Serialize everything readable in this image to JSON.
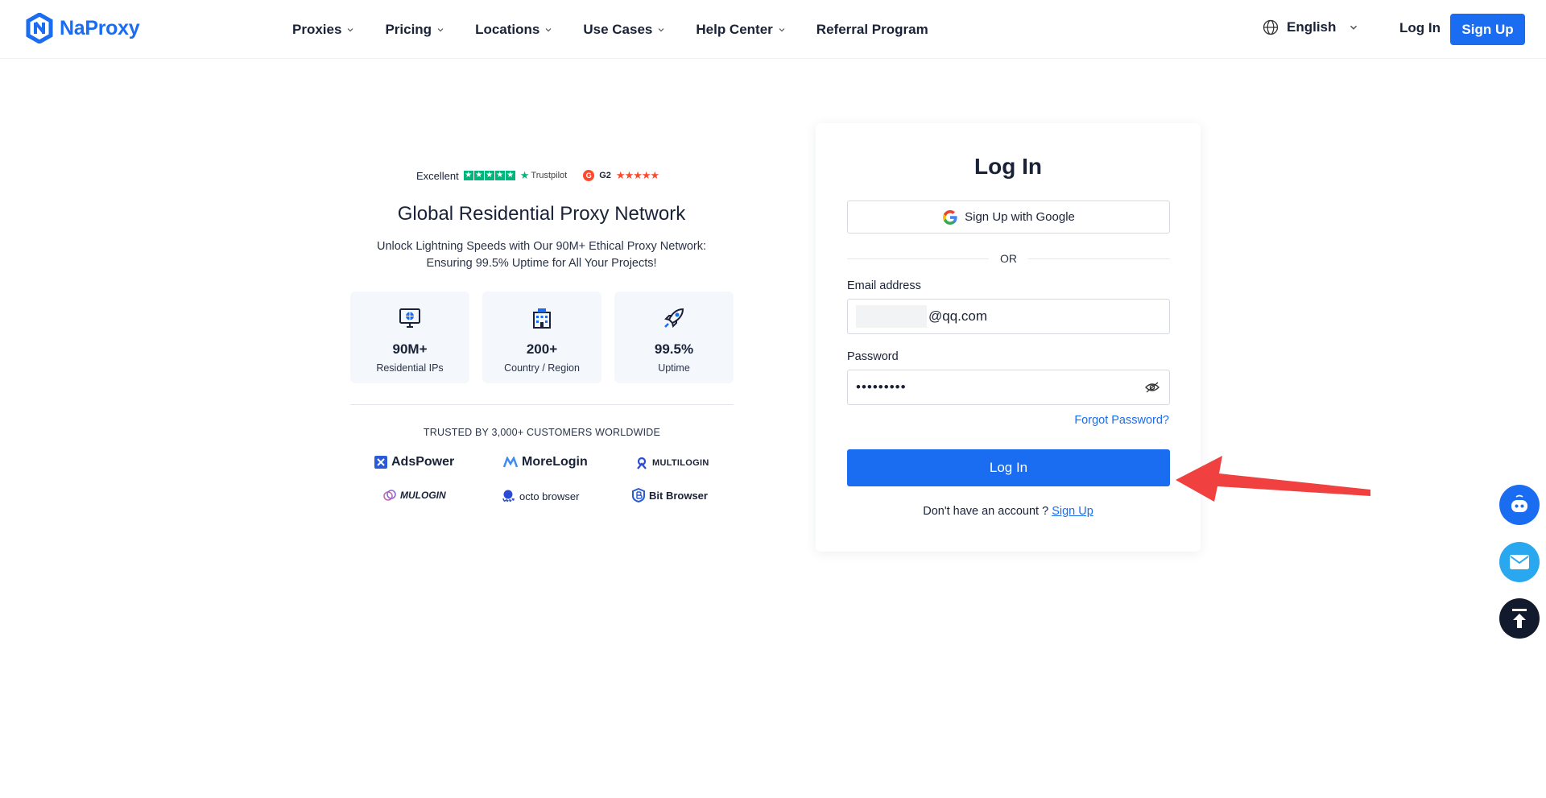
{
  "header": {
    "brand": "NaProxy",
    "nav": [
      {
        "label": "Proxies",
        "dropdown": true
      },
      {
        "label": "Pricing",
        "dropdown": true
      },
      {
        "label": "Locations",
        "dropdown": true
      },
      {
        "label": "Use Cases",
        "dropdown": true
      },
      {
        "label": "Help Center",
        "dropdown": true
      },
      {
        "label": "Referral Program",
        "dropdown": false
      }
    ],
    "language": "English",
    "login_label": "Log In",
    "signup_label": "Sign Up"
  },
  "promo": {
    "ratings": {
      "trustpilot_word": "Excellent",
      "trustpilot_brand": "Trustpilot",
      "g2_label": "G2"
    },
    "title": "Global Residential Proxy Network",
    "subtitle_line1": "Unlock Lightning Speeds with Our 90M+ Ethical Proxy Network:",
    "subtitle_line2": "Ensuring 99.5% Uptime for All Your Projects!",
    "stats": [
      {
        "value": "90M+",
        "label": "Residential IPs",
        "icon": "monitor-globe-icon"
      },
      {
        "value": "200+",
        "label": "Country / Region",
        "icon": "building-icon"
      },
      {
        "value": "99.5%",
        "label": "Uptime",
        "icon": "rocket-icon"
      }
    ],
    "trusted_text": "TRUSTED BY 3,000+ CUSTOMERS WORLDWIDE",
    "partners": [
      "AdsPower",
      "MoreLogin",
      "MULTILOGIN",
      "MULOGIN",
      "octo browser",
      "Bit Browser"
    ]
  },
  "login": {
    "title": "Log In",
    "google_label": "Sign Up with Google",
    "or_text": "OR",
    "email_label": "Email address",
    "email_value_visible": "@qq.com",
    "password_label": "Password",
    "password_value": "•••••••••",
    "forgot_label": "Forgot Password?",
    "submit_label": "Log In",
    "no_account_text": "Don't have an account ?",
    "signup_link": "Sign Up"
  },
  "colors": {
    "primary": "#1a6cf0",
    "annotation_arrow": "#f04040",
    "trustpilot_green": "#00b67a",
    "g2_red": "#ff492c"
  }
}
